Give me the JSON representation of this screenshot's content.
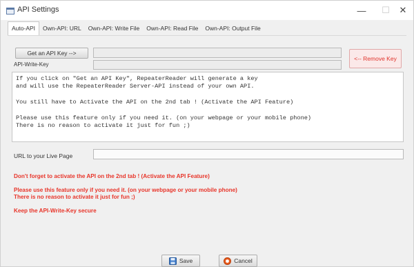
{
  "window": {
    "title": "API Settings",
    "minimize_glyph": "—",
    "maximize_glyph": "☐",
    "close_glyph": "✕"
  },
  "tabs": [
    {
      "label": "Auto-API",
      "active": true
    },
    {
      "label": "Own-API: URL",
      "active": false
    },
    {
      "label": "Own-API: Write File",
      "active": false
    },
    {
      "label": "Own-API: Read File",
      "active": false
    },
    {
      "label": "Own-API: Output File",
      "active": false
    }
  ],
  "auto_api": {
    "get_key_label": "Get an API Key -->",
    "api_key_value": "",
    "remove_key_label": "<-- Remove Key",
    "write_key_label": "API-Write-Key",
    "write_key_value": "",
    "info_lines": [
      "If you click on \"Get an API Key\", RepeaterReader will generate a key",
      "and will use the RepeaterReader Server-API instead of your own API.",
      "",
      "You still have to Activate the API on the 2nd tab ! (Activate the API Feature)",
      "",
      "Please use this feature only if you need it. (on your webpage or your mobile phone)",
      "There is no reason to activate it just for fun ;)"
    ],
    "url_label": "URL to your Live Page",
    "url_value": "",
    "warnings": [
      "Don't forget to activate  the API on the 2nd tab ! (Activate the API Feature)",
      "Please use this feature only if you need it. (on your webpage or your mobile phone)",
      "There is no reason to activate it just for fun ;)",
      "Keep the API-Write-Key secure"
    ]
  },
  "footer": {
    "save_label": "Save",
    "cancel_label": "Cancel"
  },
  "colors": {
    "warning_red": "#e8352a",
    "remove_bg": "#fbe9e9"
  },
  "icons": {
    "app": "settings-app-icon",
    "save": "floppy-disk-icon",
    "cancel": "cancel-circle-icon"
  }
}
